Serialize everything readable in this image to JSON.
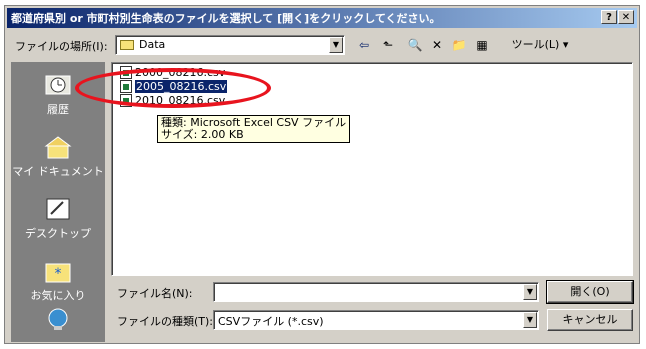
{
  "window": {
    "title": "都道府県別 or 市町村別生命表のファイルを選択して [開く]をクリックしてください。",
    "help_btn": "?",
    "close_btn": "✕"
  },
  "toolbar": {
    "lookin_label": "ファイルの場所(I):",
    "lookin_value": "Data",
    "back_icon": "⇦",
    "up_icon": "⬑",
    "search_icon": "🔍",
    "delete_icon": "✕",
    "newfolder_icon": "📁",
    "views_icon": "▦",
    "tools_label": "ツール(L)"
  },
  "places": [
    {
      "label": "履歴",
      "icon": "history-icon"
    },
    {
      "label": "マイ ドキュメント",
      "icon": "my-documents-icon"
    },
    {
      "label": "デスクトップ",
      "icon": "desktop-icon"
    },
    {
      "label": "お気に入り",
      "icon": "favorites-icon"
    },
    {
      "label": "",
      "icon": "network-icon"
    }
  ],
  "files": [
    {
      "name": "2000_08216.csv",
      "selected": false
    },
    {
      "name": "2005_08216.csv",
      "selected": true
    },
    {
      "name": "2010_08216.csv",
      "selected": false
    }
  ],
  "tooltip": {
    "line1": "種類: Microsoft Excel CSV ファイル",
    "line2": "サイズ: 2.00 KB"
  },
  "filename": {
    "label": "ファイル名(N):",
    "value": ""
  },
  "filetype": {
    "label": "ファイルの種類(T):",
    "value": "CSVファイル (*.csv)"
  },
  "buttons": {
    "open": "開く(O)",
    "cancel": "キャンセル"
  },
  "colors": {
    "title_start": "#0a246a",
    "title_end": "#a6caf0",
    "annotation": "#e8141e",
    "selection": "#0a246a"
  }
}
